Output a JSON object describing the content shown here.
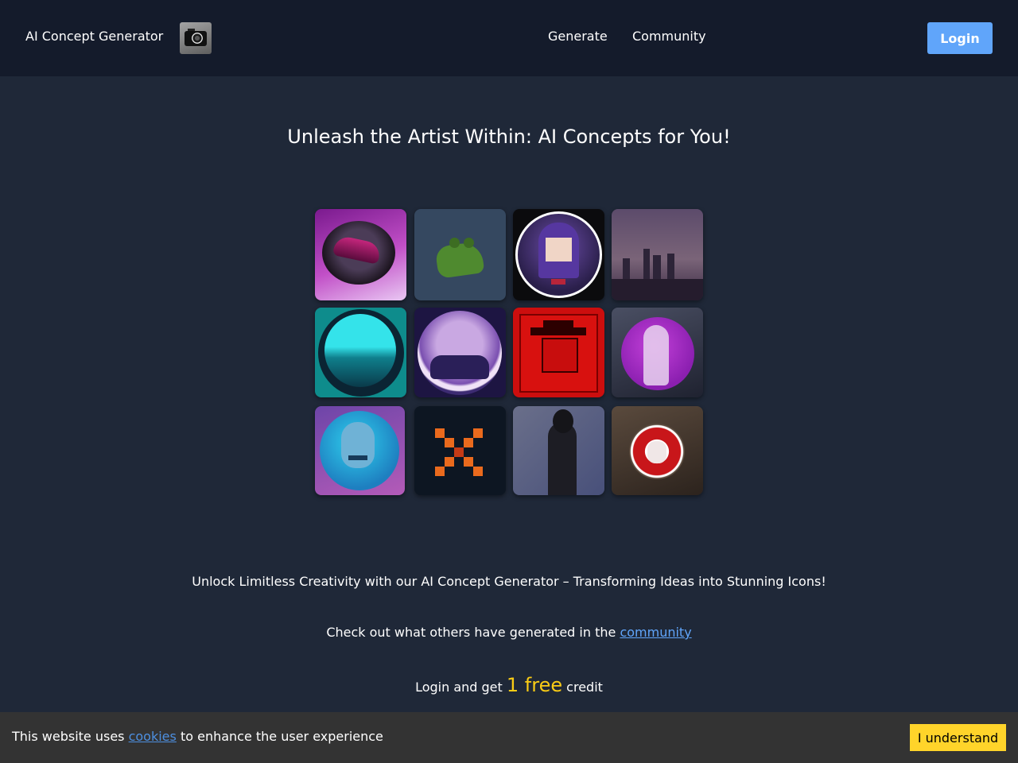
{
  "header": {
    "brand": "AI Concept Generator",
    "logo_icon": "camera-icon",
    "nav": [
      {
        "label": "Generate"
      },
      {
        "label": "Community"
      }
    ],
    "login_label": "Login"
  },
  "hero": {
    "title": "Unleash the Artist Within: AI Concepts for You!"
  },
  "gallery": {
    "count": 12
  },
  "tagline": "Unlock Limitless Creativity with our AI Concept Generator – Transforming Ideas into Stunning Icons!",
  "community_line": {
    "prefix": "Check out what others have generated in the ",
    "link": "community"
  },
  "credit_line": {
    "prefix": "Login and get ",
    "amount": "1 free",
    "suffix": " credit"
  },
  "cookie_banner": {
    "prefix": "This website uses ",
    "link": "cookies",
    "suffix": " to enhance the user experience",
    "button": "I understand"
  },
  "colors": {
    "background": "#1f2838",
    "header_bg": "#141b2b",
    "accent": "#60a5fa",
    "highlight": "#facc15",
    "cookie_bg": "#333333",
    "cookie_button": "#ffd42a"
  }
}
